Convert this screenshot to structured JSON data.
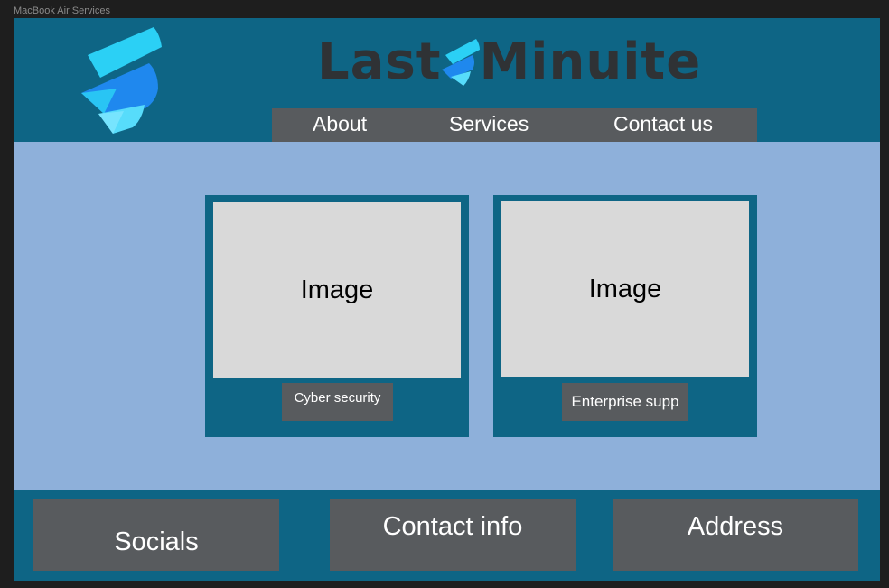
{
  "frame": {
    "label": "MacBook Air Services"
  },
  "header": {
    "brand_left": "Last",
    "brand_right": "Minuite",
    "logo_icon": "stacked-f-logo-icon",
    "nav": [
      {
        "label": "About"
      },
      {
        "label": "Services"
      },
      {
        "label": "Contact us"
      }
    ]
  },
  "cards": [
    {
      "image_text": "Image",
      "label": "Cyber security"
    },
    {
      "image_text": "Image",
      "label": "Enterprise supp"
    }
  ],
  "footer": {
    "items": [
      {
        "label": "Socials"
      },
      {
        "label": "Contact info"
      },
      {
        "label": "Address"
      }
    ]
  },
  "colors": {
    "background": "#1e1e1e",
    "header": "#0e6585",
    "body": "#8eb0da",
    "panel_gray": "#585b5e",
    "image_placeholder": "#d9d9d9",
    "logo_cyan": "#2bd0f5",
    "logo_blue": "#1f88ee",
    "brand_text": "#2f3235"
  }
}
